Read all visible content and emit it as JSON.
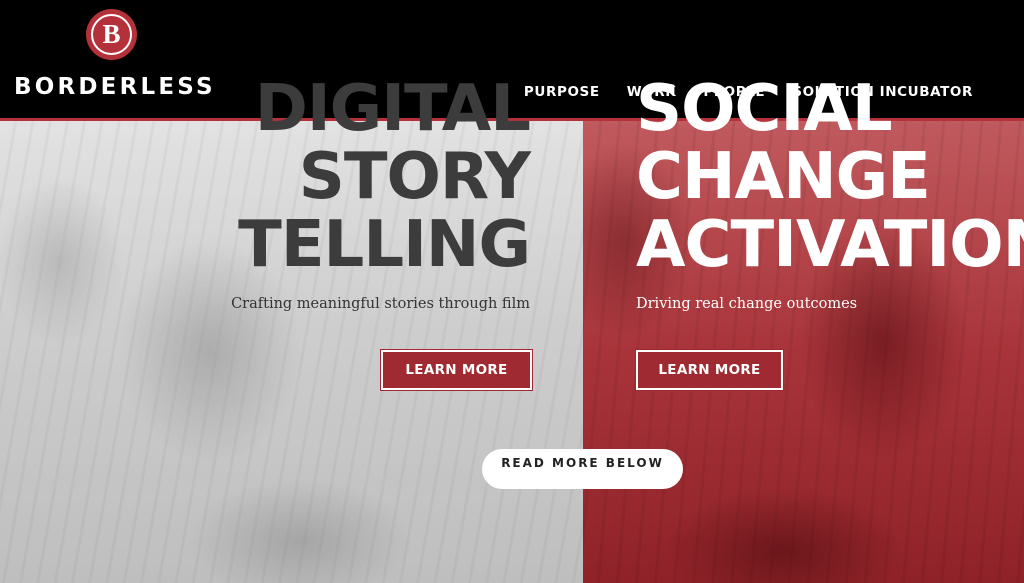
{
  "brand": {
    "name": "BORDERLESS",
    "logo_letter": "B",
    "accent_color": "#b5313a"
  },
  "nav": {
    "items": [
      {
        "label": "PURPOSE"
      },
      {
        "label": "WORK"
      },
      {
        "label": "PEOPLE"
      },
      {
        "label": "SOLUTION INCUBATOR"
      }
    ]
  },
  "hero": {
    "left": {
      "headline": [
        "DIGITAL",
        "STORY",
        "TELLING"
      ],
      "subtitle": "Crafting meaningful stories through film",
      "button_label": "LEARN MORE"
    },
    "right": {
      "headline": [
        "SOCIAL",
        "CHANGE",
        "ACTIVATION"
      ],
      "subtitle": "Driving real change outcomes",
      "button_label": "LEARN MORE"
    },
    "read_more_label": "READ MORE BELOW"
  }
}
